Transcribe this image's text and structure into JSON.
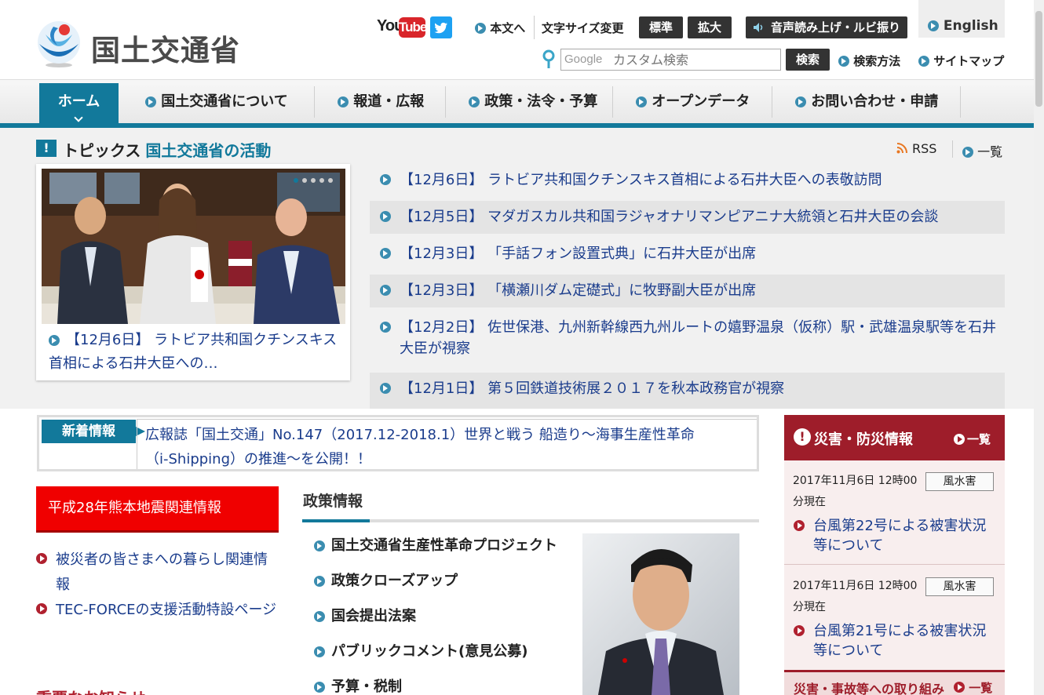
{
  "header": {
    "logo_text": "国土交通省",
    "youtube_you": "You",
    "youtube_tube": "Tube",
    "skip_to_content": "本文へ",
    "font_size_label": "文字サイズ変更",
    "font_standard": "標準",
    "font_large": "拡大",
    "voice_ruby": "音声読み上げ・ルビ振り",
    "english": "English",
    "search_google": "Google",
    "search_placeholder": "カスタム検索",
    "search_button": "検索",
    "search_method": "検索方法",
    "sitemap": "サイトマップ"
  },
  "nav": {
    "home": "ホーム",
    "items": [
      "国土交通省について",
      "報道・広報",
      "政策・法令・予算",
      "オープンデータ",
      "お問い合わせ・申請"
    ]
  },
  "topics": {
    "badge": "!",
    "title": "トピックス",
    "subtitle": "国土交通省の活動",
    "rss": "RSS",
    "all": "一覧",
    "feature_caption": "【12月6日】 ラトビア共和国クチンスキス首相による石井大臣への…",
    "items": [
      "【12月6日】 ラトビア共和国クチンスキス首相による石井大臣への表敬訪問",
      "【12月5日】 マダガスカル共和国ラジャオナリマンピアニナ大統領と石井大臣の会談",
      "【12月3日】 「手話フォン設置式典」に石井大臣が出席",
      "【12月3日】 「横瀬川ダム定礎式」に牧野副大臣が出席",
      "【12月2日】 佐世保港、九州新幹線西九州ルートの嬉野温泉（仮称）駅・武雄温泉駅等を石井大臣が視察",
      "【12月1日】 第５回鉄道技術展２０１７を秋本政務官が視察"
    ]
  },
  "news": {
    "label": "新着情報",
    "text": "広報誌「国土交通」No.147（2017.12-2018.1）世界と戦う 船造り～海事生産性革命（i-Shipping）の推進～を公開！！"
  },
  "kumamoto": {
    "title": "平成28年熊本地震関連情報",
    "links": [
      "被災者の皆さまへの暮らし関連情報",
      "TEC-FORCEの支援活動特設ページ"
    ]
  },
  "important": "重要なお知らせ",
  "policy": {
    "title": "政策情報",
    "items": [
      "国土交通省生産性革命プロジェクト",
      "政策クローズアップ",
      "国会提出法案",
      "パブリックコメント(意見公募)",
      "予算・税制"
    ]
  },
  "disaster": {
    "excl": "!",
    "title": "災害・防災情報",
    "all": "一覧",
    "items": [
      {
        "date": "2017年11月6日 12時00分現在",
        "tag": "風水害",
        "link": "台風第22号による被害状況等について"
      },
      {
        "date": "2017年11月6日 12時00分現在",
        "tag": "風水害",
        "link": "台風第21号による被害状況等について"
      }
    ],
    "bottom_label": "災害・事故等への取り組み",
    "bottom_all": "一覧"
  },
  "colors": {
    "accent": "#12799b",
    "disaster": "#9e1d2a",
    "kumamoto": "#f00000"
  }
}
